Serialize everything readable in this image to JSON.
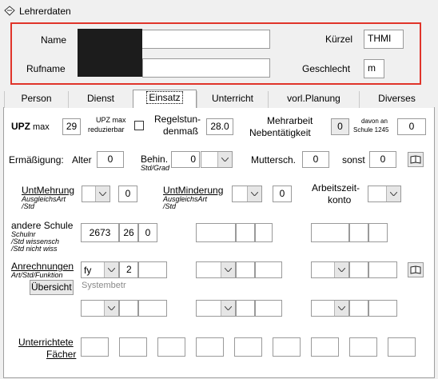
{
  "window": {
    "title": "Lehrerdaten"
  },
  "header": {
    "name_label": "Name",
    "rufname_label": "Rufname",
    "kuerzel_label": "Kürzel",
    "kuerzel_value": "THMI",
    "geschlecht_label": "Geschlecht",
    "geschlecht_value": "m"
  },
  "tabs": [
    {
      "label": "Person"
    },
    {
      "label": "Dienst"
    },
    {
      "label": "Einsatz",
      "active": true
    },
    {
      "label": "Unterricht"
    },
    {
      "label": "vorl.Planung"
    },
    {
      "label": "Diverses"
    }
  ],
  "einsatz": {
    "upz_label": "UPZ",
    "max_label": "max",
    "upz_value": "29",
    "upz_max_red_1": "UPZ max",
    "upz_max_red_2": "reduzierbar",
    "regel_1": "Regelstun-",
    "regel_2": "denmaß",
    "regel_value": "28.0",
    "mehr_1": "Mehrarbeit",
    "mehr_2": "Nebentätigkeit",
    "mehr_value": "0",
    "davon_1": "davon an",
    "davon_2": "Schule 1245",
    "davon_value": "0",
    "ermaess_label": "Ermäßigung:",
    "alter_label": "Alter",
    "alter_value": "0",
    "behin_label": "Behin.",
    "behin_sub": "Std/Grad",
    "behin_value": "0",
    "mutter_label": "Muttersch.",
    "mutter_value": "0",
    "sonst_label": "sonst",
    "sonst_value": "0",
    "untmehr_label": "UntMehrung",
    "untmehr_sub1": "AusgleichsArt",
    "untmehr_sub2": "/Std",
    "untmehr_value": "0",
    "untmind_label": "UntMinderung",
    "untmind_sub1": "AusgleichsArt",
    "untmind_sub2": "/Std",
    "untmind_value": "0",
    "arbeitszeit_1": "Arbeitszeit-",
    "arbeitszeit_2": "konto",
    "andere_label": "andere Schule",
    "andere_sub1": "Schulnr",
    "andere_sub2": "/Std wissensch",
    "andere_sub3": "/Std nicht wiss",
    "andere_schulnr": "2673",
    "andere_wiss": "26",
    "andere_nichtwiss": "0",
    "anrech_label": "Anrechnungen",
    "anrech_sub": "Art/Std/Funktion",
    "anrech_art": "fy",
    "anrech_std": "2",
    "uebersicht_label": "Übersicht",
    "systembetr_label": "Systembetr",
    "faecher_1": "Unterrichtete",
    "faecher_2": "Fächer"
  },
  "icons": {
    "app": "app-icon",
    "book": "book-icon",
    "dropdown": "chevron-down-icon"
  }
}
